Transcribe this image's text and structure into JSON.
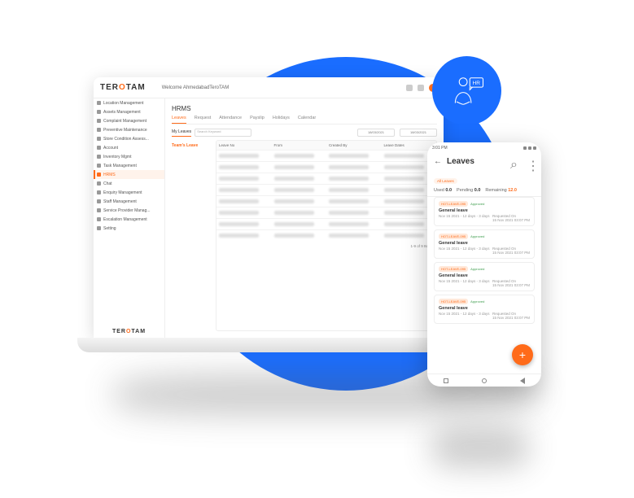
{
  "brand": "TEROTAM",
  "header": {
    "welcome": "Welcome AhmedabadTeroTAM"
  },
  "sidebar": {
    "items": [
      {
        "label": "Location Management"
      },
      {
        "label": "Assets Management"
      },
      {
        "label": "Complaint Management"
      },
      {
        "label": "Preventive Maintenance"
      },
      {
        "label": "Store Condition Assess..."
      },
      {
        "label": "Account"
      },
      {
        "label": "Inventory Mgmt"
      },
      {
        "label": "Task Management"
      },
      {
        "label": "HRMS"
      },
      {
        "label": "Chat"
      },
      {
        "label": "Enquiry Management"
      },
      {
        "label": "Staff Management"
      },
      {
        "label": "Service Provider Manag..."
      },
      {
        "label": "Escalation Management"
      },
      {
        "label": "Setting"
      }
    ],
    "active_index": 8
  },
  "page": {
    "title": "HRMS",
    "tabs": [
      "Leaves",
      "Request",
      "Attendance",
      "Payslip",
      "Holidays",
      "Calendar"
    ],
    "active_tab": 0,
    "sub_tabs": [
      "My Leaves",
      "Team's Leave"
    ],
    "active_sub_tab": 0,
    "search_placeholder": "Search Keyword",
    "date_from": "18/03/2021",
    "date_to": "18/03/2021",
    "team_label": "Team's Leave",
    "columns": [
      "Leave No",
      "From",
      "Created By",
      "Leave Dates"
    ],
    "row_count": 8,
    "pager": "1-9 of 9 Items"
  },
  "phone": {
    "time": "3:01 PM",
    "title": "Leaves",
    "summary": {
      "used_label": "Used",
      "used_val": "0.0",
      "pending_label": "Pending",
      "pending_val": "0.0",
      "remaining_label": "Remaining",
      "remaining_val": "12.0"
    },
    "top_pill": "All Leaves",
    "cards": [
      {
        "badge": "HOT-LEAVE-095",
        "status": "Approved",
        "name": "General leave",
        "meta": "Nov 15 2021 - 12 days - 3 days",
        "req_label": "Requested On",
        "req_date": "15 Nov 2021 03:07 PM"
      },
      {
        "badge": "HOT-LEAVE-095",
        "status": "Approved",
        "name": "General leave",
        "meta": "Nov 15 2021 - 12 days - 3 days",
        "req_label": "Requested On",
        "req_date": "15 Nov 2021 03:07 PM"
      },
      {
        "badge": "HOT-LEAVE-095",
        "status": "Approved",
        "name": "General leave",
        "meta": "Nov 15 2021 - 12 days - 3 days",
        "req_label": "Requested On",
        "req_date": "15 Nov 2021 03:07 PM"
      },
      {
        "badge": "HOT-LEAVE-095",
        "status": "Approved",
        "name": "General leave",
        "meta": "Nov 15 2021 - 12 days - 3 days",
        "req_label": "Requested On",
        "req_date": "15 Nov 2021 03:07 PM"
      }
    ]
  }
}
